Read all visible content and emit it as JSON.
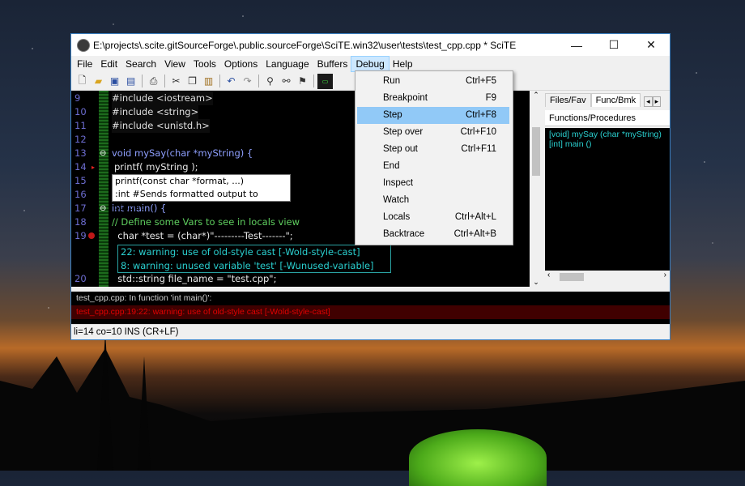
{
  "window": {
    "title": "E:\\projects\\.scite.gitSourceForge\\.public.sourceForge\\SciTE.win32\\user\\tests\\test_cpp.cpp * SciTE",
    "minimize": "—",
    "maximize": "☐",
    "close": "✕"
  },
  "menubar": [
    "File",
    "Edit",
    "Search",
    "View",
    "Tools",
    "Options",
    "Language",
    "Buffers",
    "Debug",
    "Help"
  ],
  "active_menu": "Debug",
  "editor": {
    "lines": [
      {
        "n": "9",
        "text": "#include <iostream>"
      },
      {
        "n": "10",
        "text": "#include <string>"
      },
      {
        "n": "11",
        "text": "#include <unistd.h>"
      },
      {
        "n": "12",
        "text": ""
      },
      {
        "n": "13",
        "text": "void mySay(char *myString) {"
      },
      {
        "n": "14",
        "text": "printf( myString );"
      },
      {
        "n": "15",
        "text": ""
      },
      {
        "n": "16",
        "text": ""
      },
      {
        "n": "17",
        "text": "int main() {"
      },
      {
        "n": "18",
        "text": "// Define some Vars to see in locals view"
      },
      {
        "n": "19",
        "text": "  char *test = (char*)\"---------Test-------\";"
      },
      {
        "n": "20",
        "text": "  std::string file_name = \"test.cpp\";"
      }
    ],
    "calltip": {
      "line1": "printf(const char *format, ...)",
      "line2": ":int  #Sends formatted output to stdout"
    },
    "warnings": [
      "22: warning: use of old-style cast [-Wold-style-cast]",
      "8: warning: unused variable 'test' [-Wunused-variable]"
    ]
  },
  "side": {
    "tabs": [
      "Files/Fav",
      "Func/Bmk"
    ],
    "header": "Functions/Procedures",
    "items": [
      "[void] mySay (char *myString)",
      "[int] main ()"
    ]
  },
  "output": {
    "line1": "test_cpp.cpp: In function 'int main()':",
    "line2": "test_cpp.cpp:19:22: warning: use of old-style cast [-Wold-style-cast]"
  },
  "status": "li=14 co=10 INS (CR+LF)",
  "debug_menu": [
    {
      "label": "Run",
      "key": "Ctrl+F5"
    },
    {
      "label": "Breakpoint",
      "key": "F9"
    },
    {
      "label": "Step",
      "key": "Ctrl+F8"
    },
    {
      "label": "Step over",
      "key": "Ctrl+F10"
    },
    {
      "label": "Step out",
      "key": "Ctrl+F11"
    },
    {
      "label": "End",
      "key": ""
    },
    {
      "label": "Inspect",
      "key": ""
    },
    {
      "label": "Watch",
      "key": ""
    },
    {
      "label": "Locals",
      "key": "Ctrl+Alt+L"
    },
    {
      "label": "Backtrace",
      "key": "Ctrl+Alt+B"
    }
  ],
  "highlighted_item": "Step",
  "colors": {
    "accent": "#91c9f7",
    "editor_bg": "#000000",
    "warning": "#2ad0d0",
    "error": "#e00000"
  }
}
